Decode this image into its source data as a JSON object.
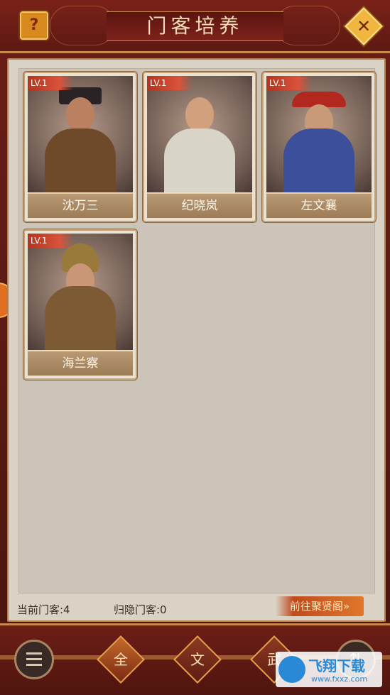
{
  "header": {
    "title": "门客培养",
    "help_label": "?",
    "close_label": "✕"
  },
  "retainers": [
    {
      "level": "LV.1",
      "name": "沈万三"
    },
    {
      "level": "LV.1",
      "name": "纪晓岚"
    },
    {
      "level": "LV.1",
      "name": "左文襄"
    },
    {
      "level": "LV.1",
      "name": "海兰察"
    }
  ],
  "footer": {
    "current_label": "当前门客:4",
    "retired_label": "归隐门客:0",
    "goto_label": "前往聚贤阁»"
  },
  "filters": {
    "all": "全",
    "civil": "文",
    "military": "武"
  },
  "watermark": {
    "text": "飞翔下载",
    "url": "www.fxxz.com"
  },
  "icons": {
    "menu": "menu-icon",
    "help": "help-icon",
    "close": "close-icon"
  }
}
